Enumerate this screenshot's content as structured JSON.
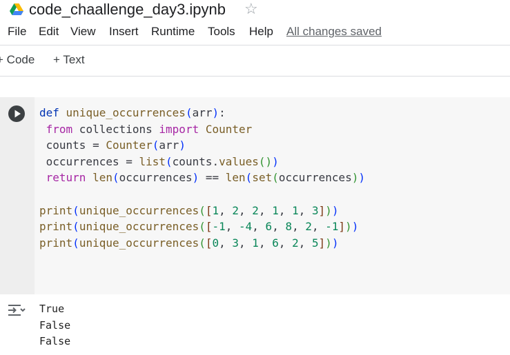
{
  "document": {
    "title": "code_chaallenge_day3.ipynb",
    "star_icon": "star-outline-icon",
    "logo_icon": "google-drive-logo"
  },
  "menu": {
    "items": [
      "File",
      "Edit",
      "View",
      "Insert",
      "Runtime",
      "Tools",
      "Help"
    ],
    "save_status": "All changes saved"
  },
  "toolbar": {
    "add_code": "Code",
    "add_text": "Text"
  },
  "cell": {
    "run_icon": "play-circle-icon",
    "code_lines": [
      "def unique_occurrences(arr):",
      " from collections import Counter",
      " counts = Counter(arr)",
      " occurrences = list(counts.values())",
      " return len(occurrences) == len(set(occurrences))",
      "",
      "print(unique_occurrences([1, 2, 2, 1, 1, 3]))",
      "print(unique_occurrences([-1, -4, 6, 8, 2, -1]))",
      "print(unique_occurrences([0, 3, 1, 6, 2, 5]))"
    ]
  },
  "output": {
    "icon": "output-toggle-icon",
    "lines": [
      "True",
      "False",
      "False"
    ]
  },
  "colors": {
    "keyword": "#0033b3",
    "import_keyword": "#a626a4",
    "function": "#795e26",
    "number": "#098658",
    "cell_background": "#f7f7f7"
  }
}
